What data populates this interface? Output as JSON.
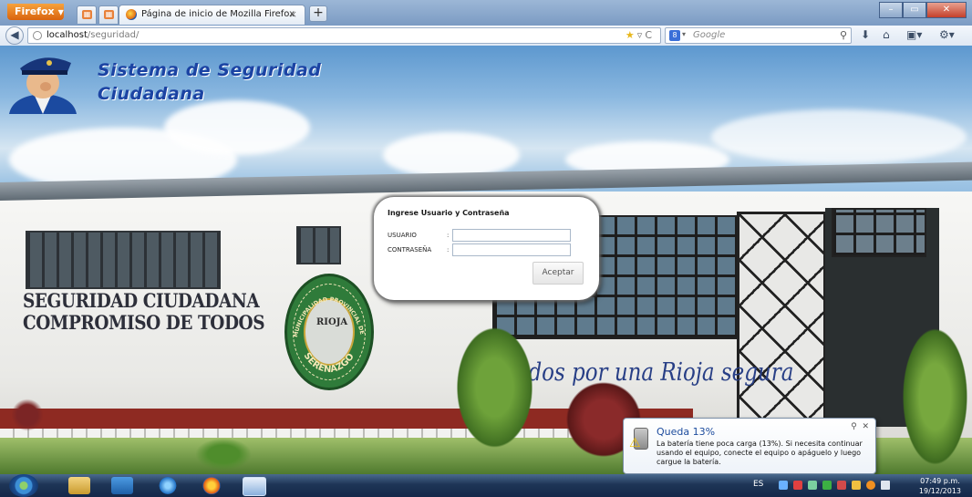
{
  "browser": {
    "menu_label": "Firefox",
    "tab_title": "Página de inicio de Mozilla Firefox",
    "tab_close": "×",
    "new_tab": "+",
    "url_host": "localhost",
    "url_path": "/seguridad/",
    "search_engine": "8",
    "search_placeholder": "Google",
    "window_buttons": [
      "–",
      "▭",
      "✕"
    ]
  },
  "page": {
    "header_line1": "Sistema de Seguridad",
    "header_line2": "Ciudadana",
    "wall_line1": "SEGURIDAD CIUDADANA",
    "wall_line2": "COMPROMISO DE TODOS",
    "emblem_top": "MUNICIPALIDAD PROVINCIAL DE RIOJA",
    "emblem_center": "RIOJA",
    "emblem_bottom": "SERENAZGO",
    "slogan": "Unidos por una Rioja segura"
  },
  "login": {
    "heading": "Ingrese Usuario y Contraseña",
    "user_label": "USUARIO",
    "password_label": "CONTRASEÑA",
    "separator": ":",
    "user_value": "",
    "password_value": "",
    "submit_label": "Aceptar"
  },
  "notification": {
    "title": "Queda 13%",
    "body": "La batería tiene poca carga (13%). Si necesita continuar usando el equipo, conecte el equipo o apáguelo y luego cargue la batería.",
    "close": "✕",
    "pin": "⚲"
  },
  "taskbar": {
    "language": "ES",
    "time": "07:49 p.m.",
    "date": "19/12/2013"
  },
  "colors": {
    "header_title": "#1b43a3",
    "firefox_orange": "#d9630d",
    "slogan_blue": "#283f86",
    "notification_title": "#1c4b9d"
  }
}
